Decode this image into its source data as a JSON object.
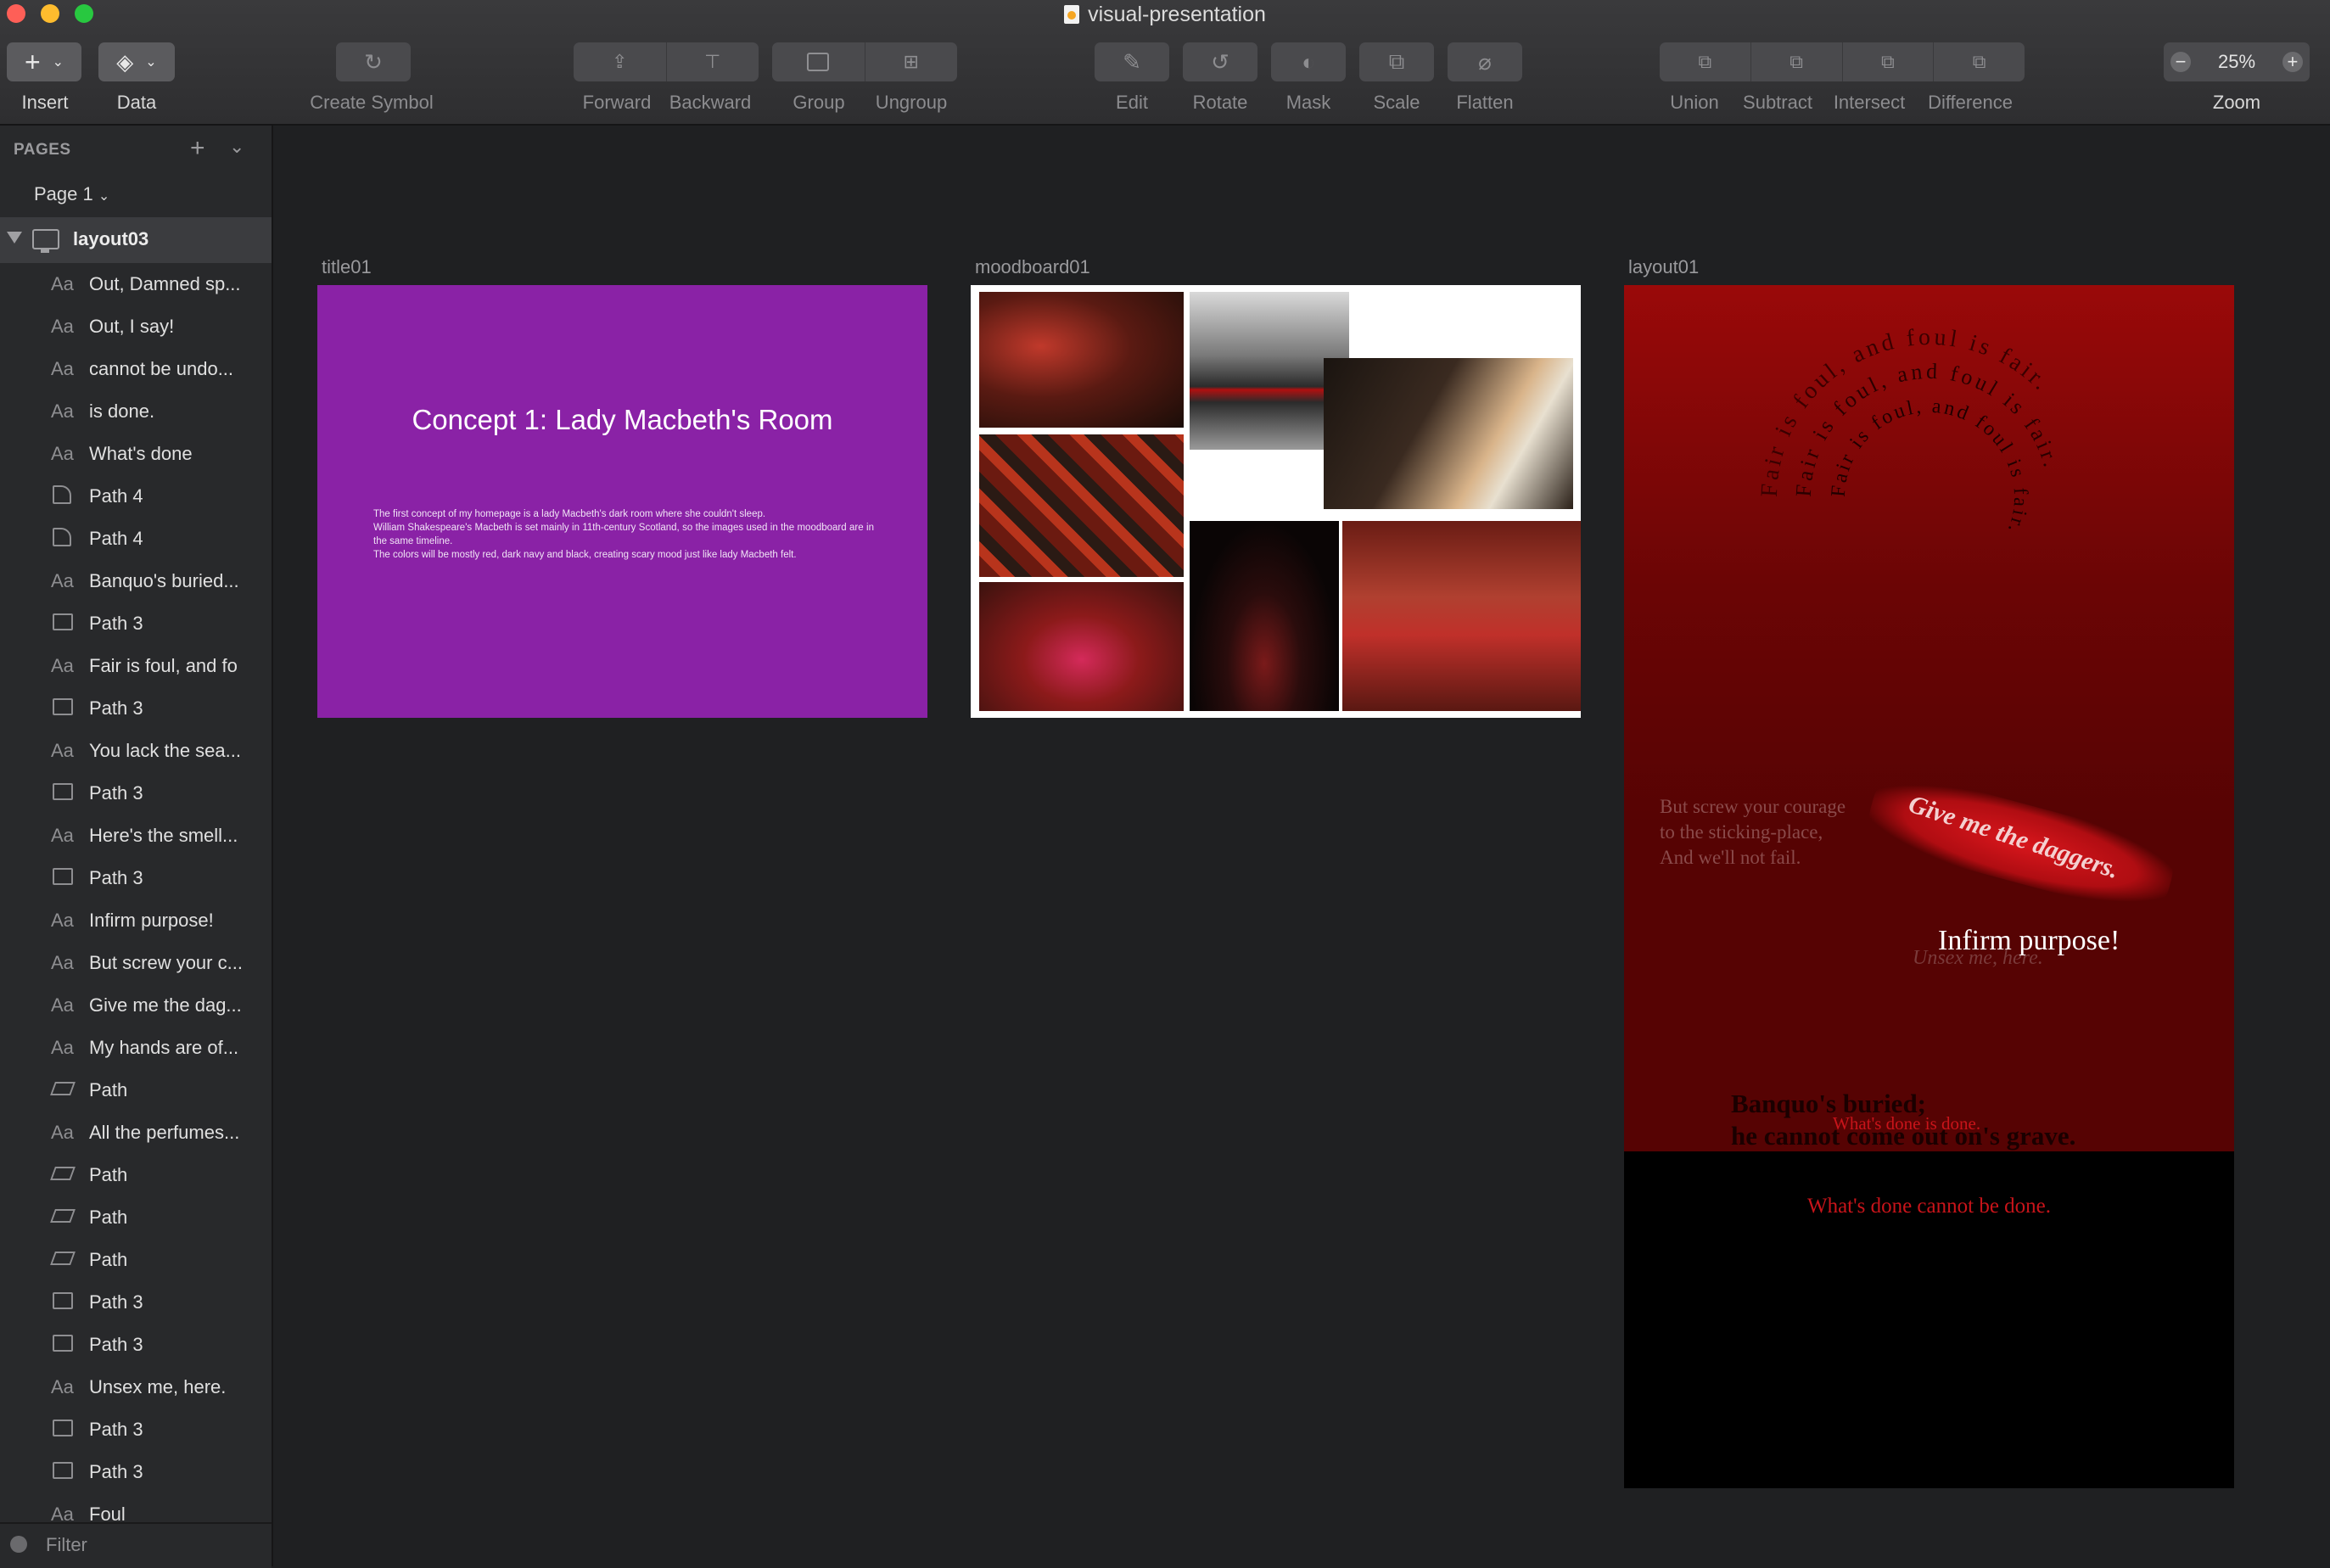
{
  "window": {
    "title": "visual-presentation"
  },
  "toolbar": {
    "insert": "Insert",
    "data": "Data",
    "create_symbol": "Create Symbol",
    "forward": "Forward",
    "backward": "Backward",
    "group": "Group",
    "ungroup": "Ungroup",
    "edit": "Edit",
    "rotate": "Rotate",
    "mask": "Mask",
    "scale": "Scale",
    "flatten": "Flatten",
    "union": "Union",
    "subtract": "Subtract",
    "intersect": "Intersect",
    "difference": "Difference",
    "zoom_label": "Zoom",
    "zoom_value": "25%"
  },
  "sidebar": {
    "pages_header": "PAGES",
    "current_page": "Page 1",
    "artboard": "layout03",
    "layers": [
      {
        "kind": "text",
        "name": "Out, Damned sp..."
      },
      {
        "kind": "text",
        "name": "Out, I say!"
      },
      {
        "kind": "text",
        "name": "cannot be undo..."
      },
      {
        "kind": "text",
        "name": "is done."
      },
      {
        "kind": "text",
        "name": "What's done"
      },
      {
        "kind": "curve",
        "name": "Path 4"
      },
      {
        "kind": "curve",
        "name": "Path 4"
      },
      {
        "kind": "text",
        "name": "Banquo's buried..."
      },
      {
        "kind": "box",
        "name": "Path 3"
      },
      {
        "kind": "text",
        "name": "Fair is foul, and fo"
      },
      {
        "kind": "box",
        "name": "Path 3"
      },
      {
        "kind": "text",
        "name": "You lack the sea..."
      },
      {
        "kind": "box",
        "name": "Path 3"
      },
      {
        "kind": "text",
        "name": "Here's the smell..."
      },
      {
        "kind": "box",
        "name": "Path 3"
      },
      {
        "kind": "text",
        "name": "Infirm purpose!"
      },
      {
        "kind": "text",
        "name": "But screw your c..."
      },
      {
        "kind": "text",
        "name": "Give me the dag..."
      },
      {
        "kind": "text",
        "name": "My hands are of..."
      },
      {
        "kind": "para",
        "name": "Path"
      },
      {
        "kind": "text",
        "name": "All the perfumes..."
      },
      {
        "kind": "para",
        "name": "Path"
      },
      {
        "kind": "para",
        "name": "Path"
      },
      {
        "kind": "para",
        "name": "Path"
      },
      {
        "kind": "box",
        "name": "Path 3"
      },
      {
        "kind": "box",
        "name": "Path 3"
      },
      {
        "kind": "text",
        "name": "Unsex me, here."
      },
      {
        "kind": "box",
        "name": "Path 3"
      },
      {
        "kind": "box",
        "name": "Path 3"
      },
      {
        "kind": "text",
        "name": "Foul"
      }
    ],
    "filter": "Filter",
    "text_icon": "Aa"
  },
  "canvas": {
    "artboards": {
      "title01": {
        "label": "title01",
        "heading": "Concept 1: Lady Macbeth's Room",
        "lines": [
          "The first concept of my homepage is a lady Macbeth's dark room where she couldn't sleep.",
          "William Shakespeare's Macbeth is set mainly in 11th-century Scotland, so the images used in the moodboard are in the same timeline.",
          "The colors will be mostly red, dark navy and black, creating scary mood just like lady Macbeth felt."
        ]
      },
      "moodboard01": {
        "label": "moodboard01"
      },
      "layout01": {
        "label": "layout01",
        "courage": [
          "But screw your courage",
          "to the sticking-place,",
          "And we'll not fail."
        ],
        "daggers": "Give me the daggers.",
        "infirm": "Infirm purpose!",
        "unsex": "Unsex me, here.",
        "banquo": [
          "Banquo's buried;",
          "he cannot come out on's grave."
        ],
        "whats_done_is_done": "What's done is done.",
        "whats_done_cannot": "What's done cannot be done.",
        "swirl": "Fair is foul, and foul is fair."
      }
    }
  },
  "colors": {
    "title_bg": "#8a22a6",
    "layout_red": "#9a0909",
    "accent_red": "#c8141a"
  }
}
